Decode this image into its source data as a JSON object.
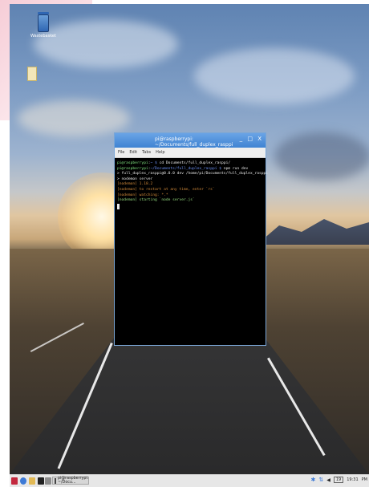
{
  "desktop": {
    "trash_label": "Wastebasket"
  },
  "terminal": {
    "title": "pi@raspberrypi: ~/Documents/full_duplex_rasppi",
    "controls": "_ □ X",
    "menu": [
      "File",
      "Edit",
      "Tabs",
      "Help"
    ],
    "lines": [
      {
        "prompt_user": "pi@raspberrypi",
        "prompt_path": "~ $",
        "cmd": "cd Documents/full_duplex_rasppi/"
      },
      {
        "prompt_user": "pi@raspberrypi",
        "prompt_path": "~/Documents/full_duplex_rasppi $",
        "cmd": "npm run dev"
      },
      {
        "text": ""
      },
      {
        "text": "> full_duplex_rasppi@0.0.0 dev /home/pi/Documents/full_duplex_rasppi"
      },
      {
        "text": "> nodemon server"
      },
      {
        "text": ""
      },
      {
        "nodemon": "[nodemon] 1.18.2"
      },
      {
        "nodemon": "[nodemon] to restart at any time, enter `rs`"
      },
      {
        "nodemon": "[nodemon] watching: *.*"
      },
      {
        "nodemon_start": "[nodemon] starting `node server.js`"
      }
    ]
  },
  "taskbar": {
    "task_label": "pi@raspberrypi: ~/Docu...",
    "clock": "19:31",
    "date_text": "PM"
  }
}
